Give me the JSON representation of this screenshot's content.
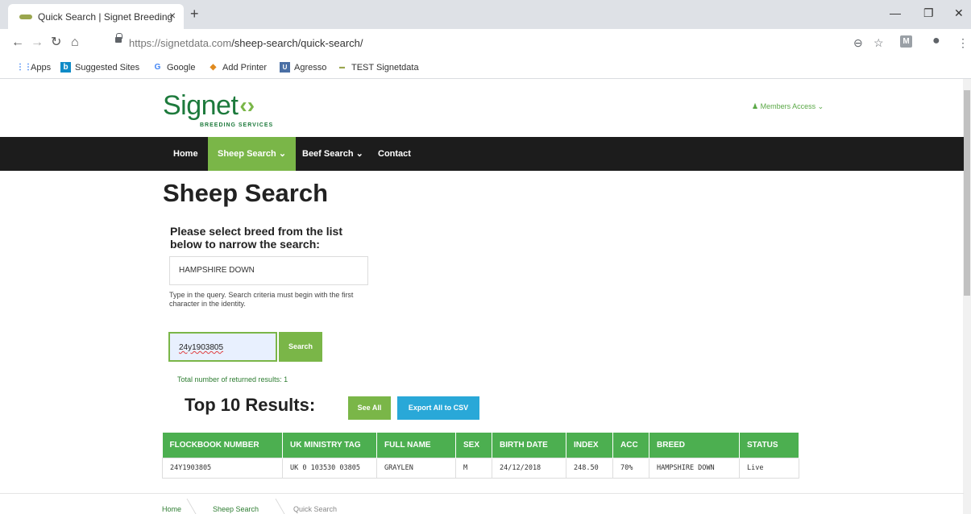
{
  "browser": {
    "tab_title": "Quick Search | Signet Breeding",
    "tab_close": "×",
    "new_tab": "+",
    "url_host": "https://signetdata.com",
    "url_path": "/sheep-search/quick-search/",
    "profile_letter": "M",
    "bookmarks": [
      {
        "label": "Apps",
        "icon": "apps-grid-icon",
        "icon_char": "⋮⋮"
      },
      {
        "label": "Suggested Sites",
        "icon": "bing-icon",
        "icon_char": "b"
      },
      {
        "label": "Google",
        "icon": "google-icon",
        "icon_char": "G"
      },
      {
        "label": "Add Printer",
        "icon": "printer-icon",
        "icon_char": "◆"
      },
      {
        "label": "Agresso",
        "icon": "agresso-icon",
        "icon_char": "U"
      },
      {
        "label": "TEST Signetdata",
        "icon": "signet-icon",
        "icon_char": "▬"
      }
    ]
  },
  "site": {
    "logo_text": "Signet",
    "logo_arrows": "‹›",
    "logo_tagline": "BREEDING SERVICES",
    "members_access": "♟ Members Access ⌄",
    "nav": [
      {
        "label": "Home"
      },
      {
        "label": "Sheep Search ⌄",
        "active": true
      },
      {
        "label": "Beef Search ⌄"
      },
      {
        "label": "Contact"
      }
    ]
  },
  "main": {
    "title": "Sheep Search",
    "prompt": "Please select breed from the list below to narrow the search:",
    "breed_value": "HAMPSHIRE DOWN",
    "hint": "Type in the query. Search criteria must begin with the first character in the identity.",
    "id_value": "24y1903805",
    "search_label": "Search",
    "results_count": "Total number of returned results: 1",
    "results_title": "Top 10 Results:",
    "see_all_label": "See All",
    "export_label": "Export All to CSV"
  },
  "table": {
    "headers": [
      "FLOCKBOOK NUMBER",
      "UK MINISTRY TAG",
      "FULL NAME",
      "SEX",
      "BIRTH DATE",
      "INDEX",
      "ACC",
      "BREED",
      "STATUS"
    ],
    "rows": [
      [
        "24Y1903805",
        "UK 0 103530 03805",
        "GRAYLEN",
        "M",
        "24/12/2018",
        "248.50",
        "70%",
        "HAMPSHIRE DOWN",
        "Live"
      ]
    ]
  },
  "breadcrumb": [
    "Home",
    "Sheep Search",
    "Quick Search"
  ],
  "colors": {
    "brand_green": "#7ab648",
    "table_header": "#4caf50",
    "export_blue": "#29a8d8",
    "navbar": "#1c1c1c"
  }
}
